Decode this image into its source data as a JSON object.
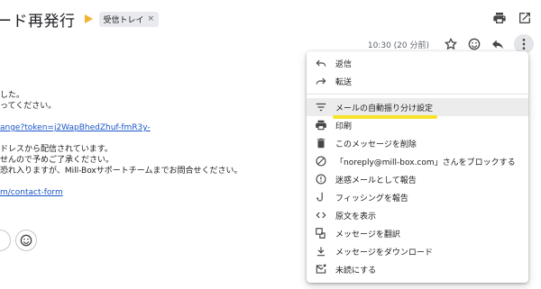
{
  "header": {
    "subject": "ード再発行",
    "label": "受信トレイ",
    "label_close": "×"
  },
  "message": {
    "time": "10:30 (20 分前)",
    "lines": [
      "した。",
      "ってください。",
      "ange?token=j2WapBhedZhuf-fmR3y-",
      "ドレスから配信されています。",
      "せんので予めご了承ください。",
      "恐れ入りますが、Mill-Boxサポートチームまでお問合せください。",
      "m/contact-form"
    ]
  },
  "menu": {
    "items": [
      {
        "label": "返信",
        "icon": "reply-icon"
      },
      {
        "label": "転送",
        "icon": "forward-icon"
      },
      {
        "label": "メールの自動振り分け設定",
        "icon": "filter-icon"
      },
      {
        "label": "印刷",
        "icon": "print-icon"
      },
      {
        "label": "このメッセージを削除",
        "icon": "trash-icon"
      },
      {
        "label": "「noreply@mill-box.com」さんをブロックする",
        "icon": "block-icon"
      },
      {
        "label": "迷惑メールとして報告",
        "icon": "spam-icon"
      },
      {
        "label": "フィッシングを報告",
        "icon": "phishing-icon"
      },
      {
        "label": "原文を表示",
        "icon": "code-icon"
      },
      {
        "label": "メッセージを翻訳",
        "icon": "translate-icon"
      },
      {
        "label": "メッセージをダウンロード",
        "icon": "download-icon"
      },
      {
        "label": "未読にする",
        "icon": "mark-unread-icon"
      }
    ]
  },
  "colors": {
    "link": "#1a56c8",
    "importance": "#f2b233",
    "highlight_underline": "#f7e32a",
    "menu_hover": "#ececec"
  }
}
